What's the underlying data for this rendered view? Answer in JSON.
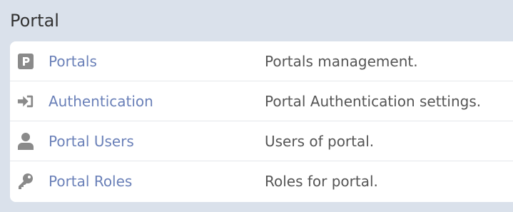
{
  "section": {
    "title": "Portal"
  },
  "colors": {
    "background": "#dae1eb",
    "link": "#6a80b8",
    "icon": "#8a8a8a",
    "text": "#555555"
  },
  "items": [
    {
      "label": "Portals",
      "description": "Portals management.",
      "icon": "parking-p-icon"
    },
    {
      "label": "Authentication",
      "description": "Portal Authentication settings.",
      "icon": "sign-in-icon"
    },
    {
      "label": "Portal Users",
      "description": "Users of portal.",
      "icon": "user-icon"
    },
    {
      "label": "Portal Roles",
      "description": "Roles for portal.",
      "icon": "key-icon"
    }
  ]
}
